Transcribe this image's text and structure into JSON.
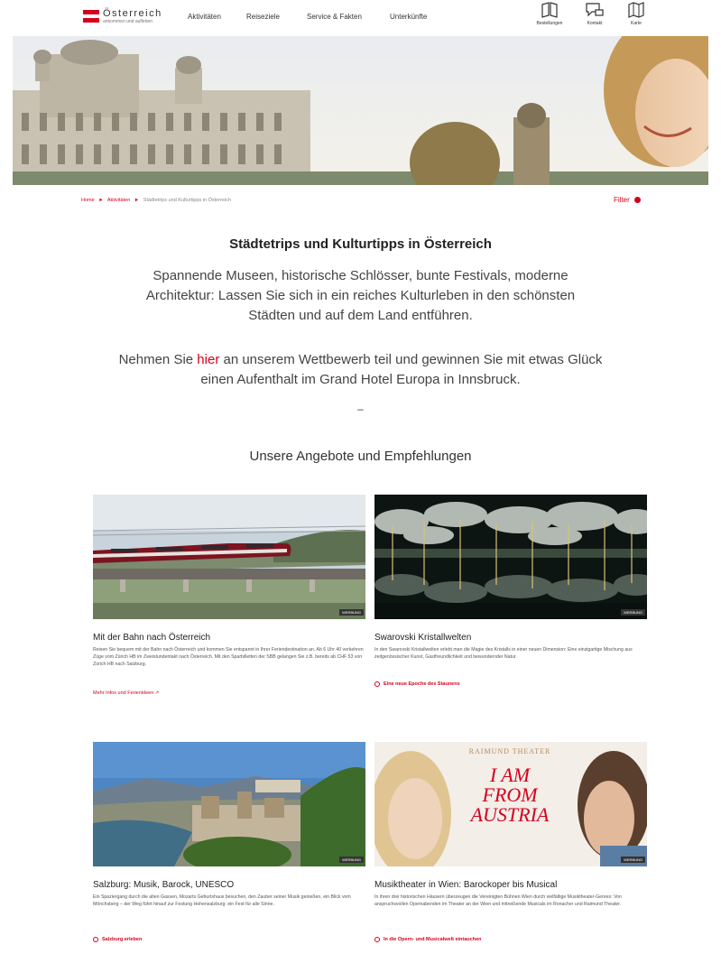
{
  "header": {
    "logo_name": "Österreich",
    "logo_tagline": "ankommen und aufleben",
    "nav": [
      "Aktivitäten",
      "Reiseziele",
      "Service & Fakten",
      "Unterkünfte"
    ],
    "tools": [
      "Bestellungen",
      "Kontakt",
      "Karte"
    ]
  },
  "breadcrumb": {
    "home": "Home",
    "sep": "►",
    "level1": "Aktivitäten",
    "current": "Städtetrips und Kulturtipps in Österreich"
  },
  "filter_label": "Filter",
  "headline": "Städtetrips und Kulturtipps in Österreich",
  "intro": "Spannende Museen, historische Schlösser, bunte Festivals, moderne Architektur: Lassen Sie sich in ein reiches Kulturleben in den schönsten Städten und auf dem Land entführen.",
  "contest": {
    "before": "Nehmen Sie ",
    "link": "hier",
    "after": " an unserem Wettbewerb teil und gewinnen Sie mit etwas Glück einen Aufenthalt im Grand Hotel Europa in Innsbruck."
  },
  "divider": "–",
  "section_title": "Unsere Angebote und Empfehlungen",
  "cards": [
    {
      "badge": "WERBUNG",
      "title": "Mit der Bahn nach Österreich",
      "desc": "Reisen Sie bequem mit der Bahn nach Österreich und kommen Sie entspannt in Ihrer Feriendestination an. Ab 6 Uhr 40 verkehren Züge vom Zürich HB im Zweistundentakt nach Österreich. Mit den Sparbilletten der SBB gelangen Sie z.B. bereits ab CHF 53 von Zürich HB nach Salzburg.",
      "link": "Mehr Infos und Ferienideen ↗"
    },
    {
      "badge": "WERBUNG",
      "title": "Swarovski Kristallwelten",
      "desc": "In den Swarovski Kristallwelten erlebt man die Magie des Kristalls in einer neuen Dimension: Eine einzigartige Mischung aus zeitgenössischer Kunst, Gastfreundlichkeit und bewundernder Natur.",
      "link": "Eine neue Epoche des Staunens"
    },
    {
      "badge": "WERBUNG",
      "title": "Salzburg: Musik, Barock, UNESCO",
      "desc": "Ein Spaziergang durch die alten Gassen, Mozarts Geburtshaus besuchen, den Zauber seiner Musik genießen, ein Blick vom Mönchsberg – der Weg führt hinauf zur Festung Hohensalzburg: ein Fest für alle Sinne.",
      "link": "Salzburg erleben"
    },
    {
      "badge": "WERBUNG",
      "title": "Musiktheater in Wien: Barockoper bis Musical",
      "desc": "In ihren drei historischen Häusern überzeugen die Vereinigten Bühnen Wien durch vielfältige Musiktheater-Genres: Von anspruchsvollen Opernabenden im Theater an der Wien und mitreißende Musicals im Ronacher und Raimund Theater.",
      "link": "In die Opern- und Musicalwelt eintauchen"
    }
  ],
  "poster": {
    "venue": "RAIMUND THEATER",
    "line1": "I AM",
    "line2": "FROM",
    "line3": "AUSTRIA"
  },
  "colors": {
    "accent": "#d6001c",
    "text": "#222222",
    "muted": "#555555"
  }
}
